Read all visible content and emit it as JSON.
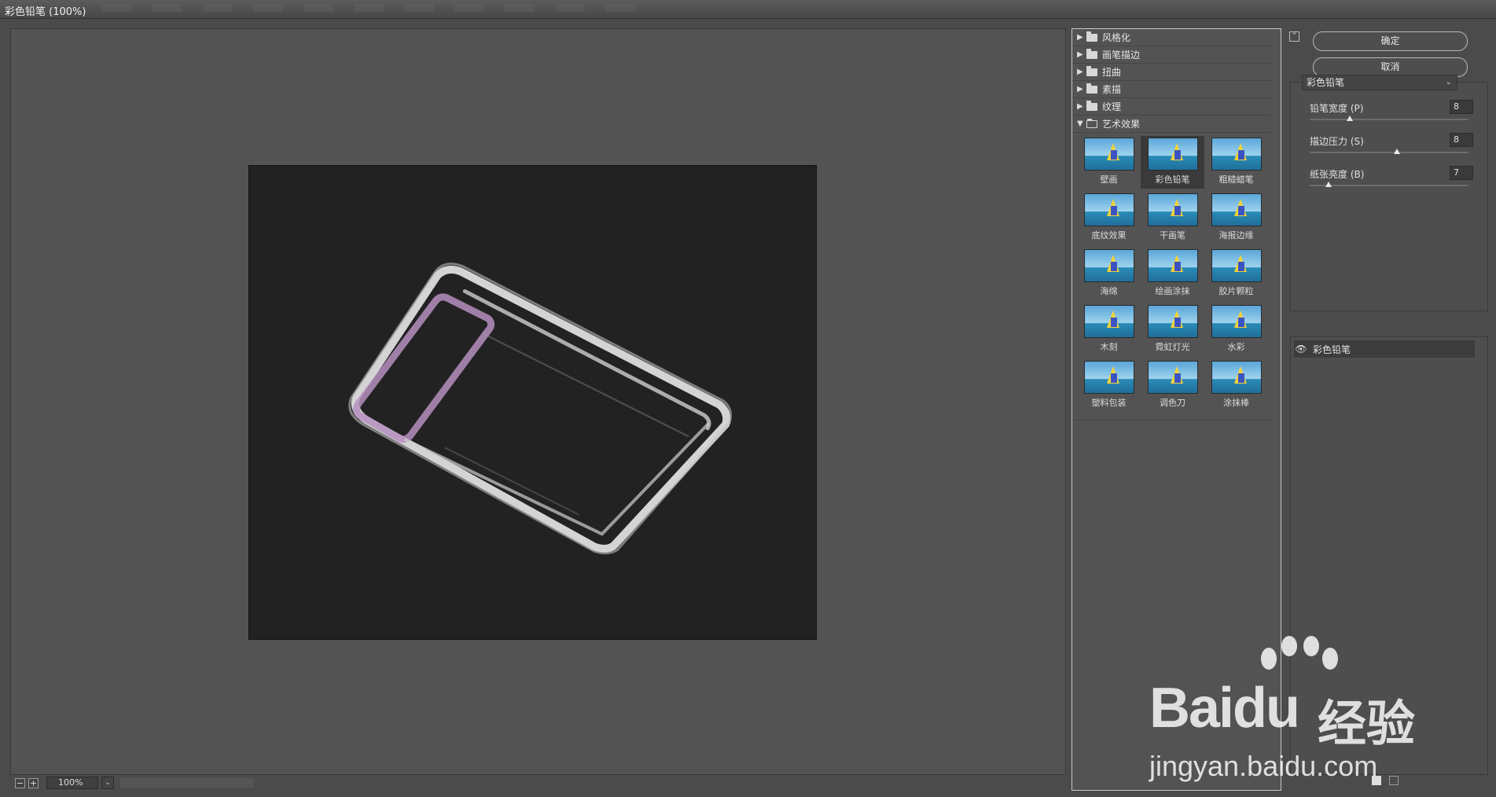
{
  "window": {
    "title": "彩色铅笔 (100%)"
  },
  "preview": {
    "zoom_minus": "−",
    "zoom_plus": "+",
    "zoom_level": "100%"
  },
  "gallery": {
    "categories": [
      {
        "label": "风格化",
        "expanded": false
      },
      {
        "label": "画笔描边",
        "expanded": false
      },
      {
        "label": "扭曲",
        "expanded": false
      },
      {
        "label": "素描",
        "expanded": false
      },
      {
        "label": "纹理",
        "expanded": false
      },
      {
        "label": "艺术效果",
        "expanded": true
      }
    ],
    "filters": [
      {
        "label": "壁画"
      },
      {
        "label": "彩色铅笔",
        "selected": true
      },
      {
        "label": "粗糙蜡笔"
      },
      {
        "label": "底纹效果"
      },
      {
        "label": "干画笔"
      },
      {
        "label": "海报边缘"
      },
      {
        "label": "海绵"
      },
      {
        "label": "绘画涂抹"
      },
      {
        "label": "胶片颗粒"
      },
      {
        "label": "木刻"
      },
      {
        "label": "霓虹灯光"
      },
      {
        "label": "水彩"
      },
      {
        "label": "塑料包装"
      },
      {
        "label": "调色刀"
      },
      {
        "label": "涂抹棒"
      }
    ]
  },
  "panel": {
    "ok_label": "确定",
    "cancel_label": "取消",
    "selected_filter": "彩色铅笔",
    "params": [
      {
        "label": "铅笔宽度 (P)",
        "value": "8",
        "fraction": 0.25
      },
      {
        "label": "描边压力 (S)",
        "value": "8",
        "fraction": 0.55
      },
      {
        "label": "纸张亮度 (B)",
        "value": "7",
        "fraction": 0.12
      }
    ]
  },
  "layers": {
    "items": [
      {
        "label": "彩色铅笔"
      }
    ]
  },
  "watermark": {
    "brand": "Bai",
    "brand_tail": "du",
    "cn": "经验",
    "url": "jingyan.baidu.com"
  },
  "colors": {
    "bg": "#4b4b4b",
    "canvas": "#222222",
    "highlight": "#b58fbf"
  }
}
